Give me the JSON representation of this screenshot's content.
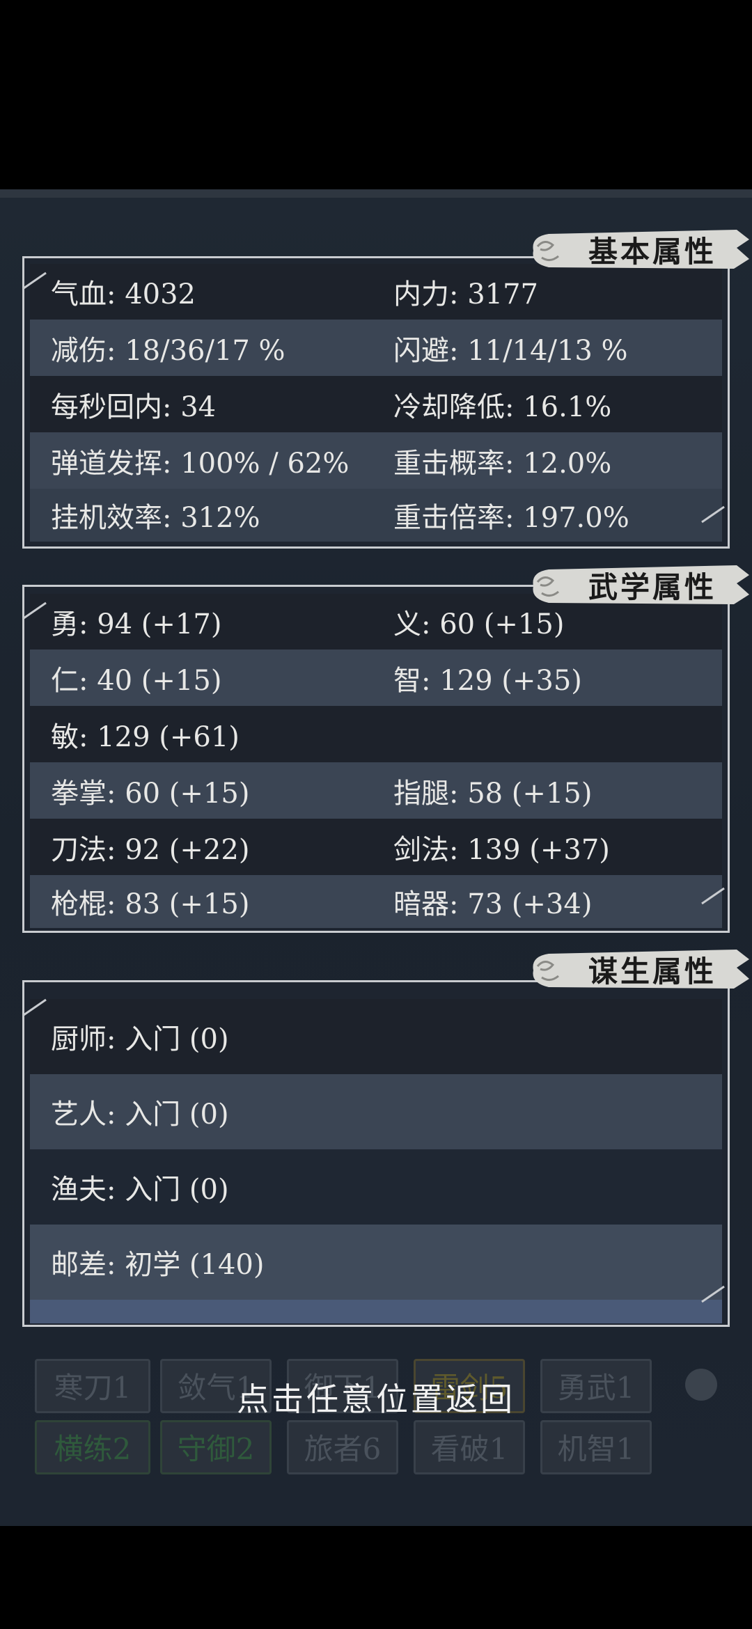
{
  "basic": {
    "title": "基本属性",
    "rows": [
      {
        "c1": "气血: 4032",
        "c2": "内力: 3177"
      },
      {
        "c1": "减伤: 18/36/17 %",
        "c2": "闪避: 11/14/13 %"
      },
      {
        "c1": "每秒回内: 34",
        "c2": "冷却降低: 16.1%"
      },
      {
        "c1": "弹道发挥: 100% / 62%",
        "c2": "重击概率: 12.0%"
      },
      {
        "c1": "挂机效率: 312%",
        "c2": "重击倍率: 197.0%"
      }
    ]
  },
  "martial": {
    "title": "武学属性",
    "rows": [
      {
        "c1": "勇: 94 (+17)",
        "c2": "义: 60 (+15)"
      },
      {
        "c1": "仁: 40 (+15)",
        "c2": "智: 129 (+35)"
      },
      {
        "c1": "敏: 129 (+61)",
        "c2": ""
      },
      {
        "c1": "拳掌: 60 (+15)",
        "c2": "指腿: 58 (+15)"
      },
      {
        "c1": "刀法: 92 (+22)",
        "c2": "剑法: 139 (+37)"
      },
      {
        "c1": "枪棍: 83 (+15)",
        "c2": "暗器: 73 (+34)"
      }
    ]
  },
  "livelihood": {
    "title": "谋生属性",
    "rows": [
      {
        "text": "厨师: 入门 (0)"
      },
      {
        "text": "艺人: 入门 (0)"
      },
      {
        "text": "渔夫: 入门 (0)"
      },
      {
        "text": "邮差: 初学 (140)"
      }
    ]
  },
  "background_skills": [
    {
      "label": "寒刀1",
      "tone": "normal"
    },
    {
      "label": "敛气1",
      "tone": "normal"
    },
    {
      "label": "御下1",
      "tone": "normal"
    },
    {
      "label": "雷剑5",
      "tone": "yellow"
    },
    {
      "label": "勇武1",
      "tone": "normal"
    },
    {
      "label": "横练2",
      "tone": "green"
    },
    {
      "label": "守御2",
      "tone": "green"
    },
    {
      "label": "旅者6",
      "tone": "normal"
    },
    {
      "label": "看破1",
      "tone": "normal"
    },
    {
      "label": "机智1",
      "tone": "normal"
    }
  ],
  "hint": "点击任意位置返回"
}
